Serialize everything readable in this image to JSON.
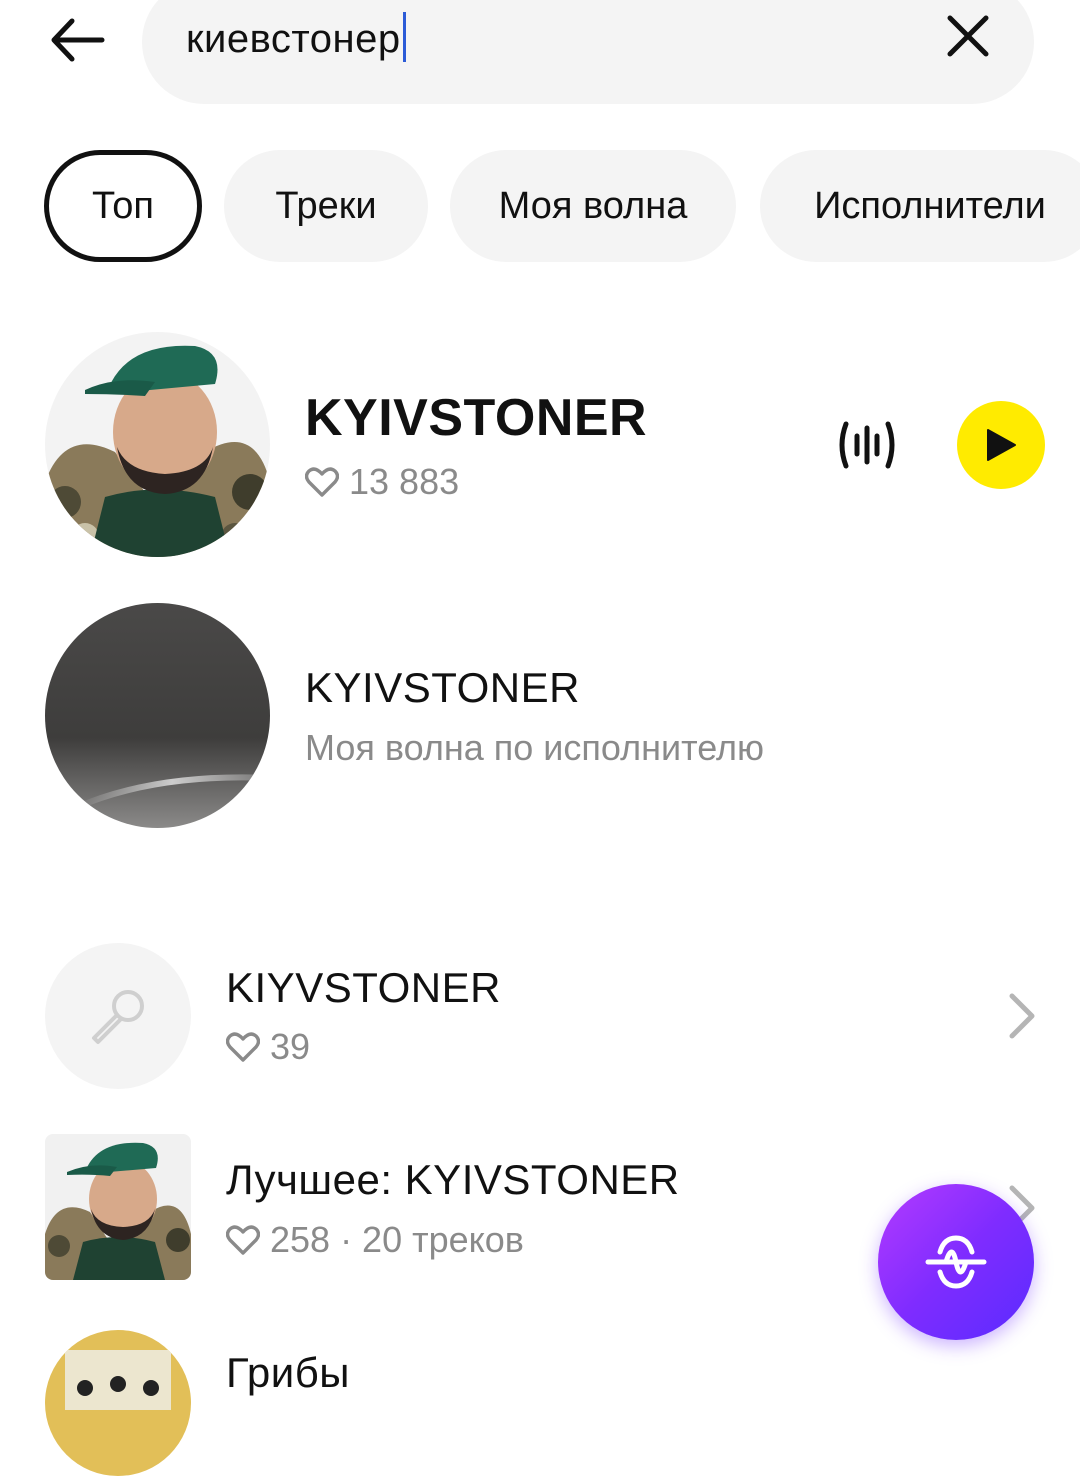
{
  "search": {
    "query": "киевстонер"
  },
  "tabs": [
    {
      "label": "Топ"
    },
    {
      "label": "Треки"
    },
    {
      "label": "Моя волна"
    },
    {
      "label": "Исполнители"
    }
  ],
  "top_artist": {
    "name": "KYIVSTONER",
    "likes": "13 883"
  },
  "artist_wave": {
    "name": "KYIVSTONER",
    "subtitle": "Моя волна по исполнителю"
  },
  "results": [
    {
      "title": "KIYVSTONER",
      "meta": "39"
    },
    {
      "title": "Лучшее: KYIVSTONER",
      "meta": "258 · 20 треков"
    },
    {
      "title": "Грибы"
    }
  ],
  "colors": {
    "accent_yellow": "#ffeb00",
    "fab_purple": "#7f2cff",
    "muted_text": "#8a8a8a"
  }
}
